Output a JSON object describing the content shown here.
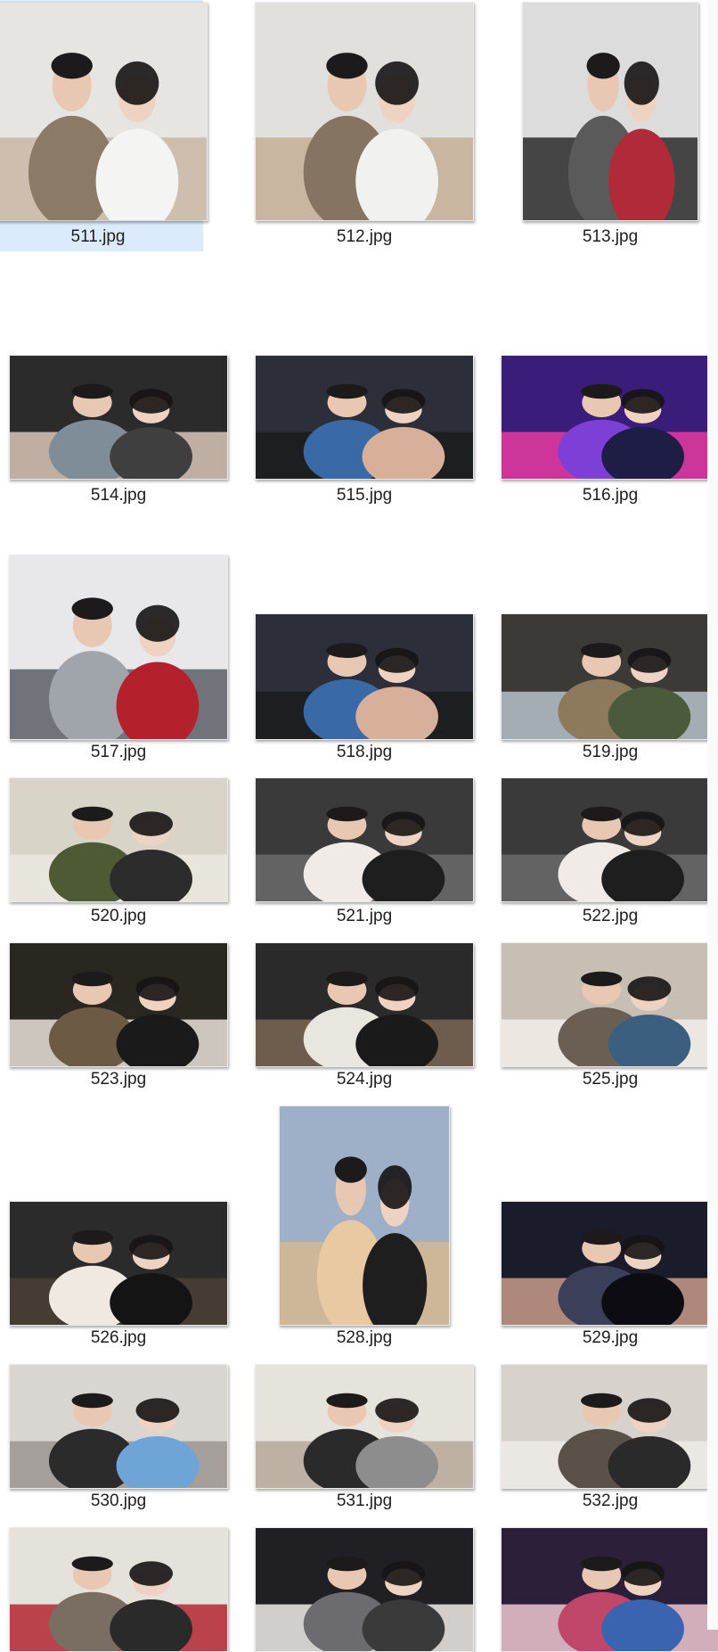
{
  "files": [
    {
      "name": "511.jpg",
      "selected": true,
      "palette": [
        "#e7e5e1",
        "#8a7a66",
        "#c9b7a3",
        "#f4f4f2"
      ],
      "orientation": "portrait-wide"
    },
    {
      "name": "512.jpg",
      "selected": false,
      "palette": [
        "#e2e0dc",
        "#857462",
        "#c4ae97",
        "#f1f1ef"
      ],
      "orientation": "portrait-wide"
    },
    {
      "name": "513.jpg",
      "selected": false,
      "palette": [
        "#dcdcdc",
        "#5a5a5a",
        "#2a2a2a",
        "#b02a3a"
      ],
      "orientation": "portrait"
    },
    {
      "name": "514.jpg",
      "selected": false,
      "palette": [
        "#2b2b2b",
        "#7f8d99",
        "#d9c7b8",
        "#3f3f3f"
      ],
      "orientation": "landscape"
    },
    {
      "name": "515.jpg",
      "selected": false,
      "palette": [
        "#2c2f3a",
        "#3a6aa6",
        "#1b1b1b",
        "#d8b09a"
      ],
      "orientation": "landscape"
    },
    {
      "name": "516.jpg",
      "selected": false,
      "palette": [
        "#3a1d7a",
        "#7d3fd6",
        "#e93aa0",
        "#1d1d46"
      ],
      "orientation": "landscape"
    },
    {
      "name": "517.jpg",
      "selected": false,
      "palette": [
        "#e8e8ea",
        "#a0a4ab",
        "#5a5e66",
        "#b4202c"
      ],
      "orientation": "landscape-tall"
    },
    {
      "name": "518.jpg",
      "selected": false,
      "palette": [
        "#2c2f3a",
        "#3a6aa6",
        "#1b1b1b",
        "#d8b09a"
      ],
      "orientation": "landscape"
    },
    {
      "name": "519.jpg",
      "selected": false,
      "palette": [
        "#3b3a36",
        "#8d7a5c",
        "#b7c2c9",
        "#4a5a3b"
      ],
      "orientation": "landscape"
    },
    {
      "name": "520.jpg",
      "selected": false,
      "palette": [
        "#d8d4c8",
        "#4d5a33",
        "#ebe8df",
        "#2c2c2c"
      ],
      "orientation": "landscape"
    },
    {
      "name": "521.jpg",
      "selected": false,
      "palette": [
        "#3a3a3a",
        "#f0ebe6",
        "#6b6b6b",
        "#1e1e1e"
      ],
      "orientation": "landscape"
    },
    {
      "name": "522.jpg",
      "selected": false,
      "palette": [
        "#3a3a3a",
        "#f0ebe6",
        "#6b6b6b",
        "#1e1e1e"
      ],
      "orientation": "landscape"
    },
    {
      "name": "523.jpg",
      "selected": false,
      "palette": [
        "#2a2620",
        "#6d5a45",
        "#e9e3db",
        "#1a1a1a"
      ],
      "orientation": "landscape"
    },
    {
      "name": "524.jpg",
      "selected": false,
      "palette": [
        "#2a2a2a",
        "#e9e5df",
        "#7a6652",
        "#1a1a1a"
      ],
      "orientation": "landscape"
    },
    {
      "name": "525.jpg",
      "selected": false,
      "palette": [
        "#c8bfb4",
        "#6b5f53",
        "#f2eee9",
        "#3d5f7f"
      ],
      "orientation": "landscape"
    },
    {
      "name": "526.jpg",
      "selected": false,
      "palette": [
        "#2b2b2b",
        "#efe9e2",
        "#4a3f36",
        "#141414"
      ],
      "orientation": "landscape"
    },
    {
      "name": "528.jpg",
      "selected": false,
      "palette": [
        "#9db0c7",
        "#e8c9a2",
        "#d7b88f",
        "#1e1e1e"
      ],
      "orientation": "portrait"
    },
    {
      "name": "529.jpg",
      "selected": false,
      "palette": [
        "#1a1c2c",
        "#3b3f5a",
        "#c89b8a",
        "#0c0c12"
      ],
      "orientation": "landscape"
    },
    {
      "name": "530.jpg",
      "selected": false,
      "palette": [
        "#d9d6d2",
        "#2b2b2b",
        "#9a9590",
        "#6fa5d6"
      ],
      "orientation": "landscape"
    },
    {
      "name": "531.jpg",
      "selected": false,
      "palette": [
        "#e6e2dc",
        "#2a2a2a",
        "#b7a79a",
        "#8d8d8d"
      ],
      "orientation": "landscape"
    },
    {
      "name": "532.jpg",
      "selected": false,
      "palette": [
        "#d7d2cc",
        "#5a5248",
        "#efebe6",
        "#2a2a2a"
      ],
      "orientation": "landscape"
    },
    {
      "name": "",
      "selected": false,
      "palette": [
        "#e5e1db",
        "#7a6e62",
        "#b32630",
        "#2a2a2a"
      ],
      "orientation": "landscape"
    },
    {
      "name": "",
      "selected": false,
      "palette": [
        "#202024",
        "#6b6b70",
        "#f1ede9",
        "#3a3a3a"
      ],
      "orientation": "landscape"
    },
    {
      "name": "",
      "selected": false,
      "palette": [
        "#2b1f3a",
        "#c1476a",
        "#f0c8d2",
        "#3a63b0"
      ],
      "orientation": "landscape"
    }
  ]
}
